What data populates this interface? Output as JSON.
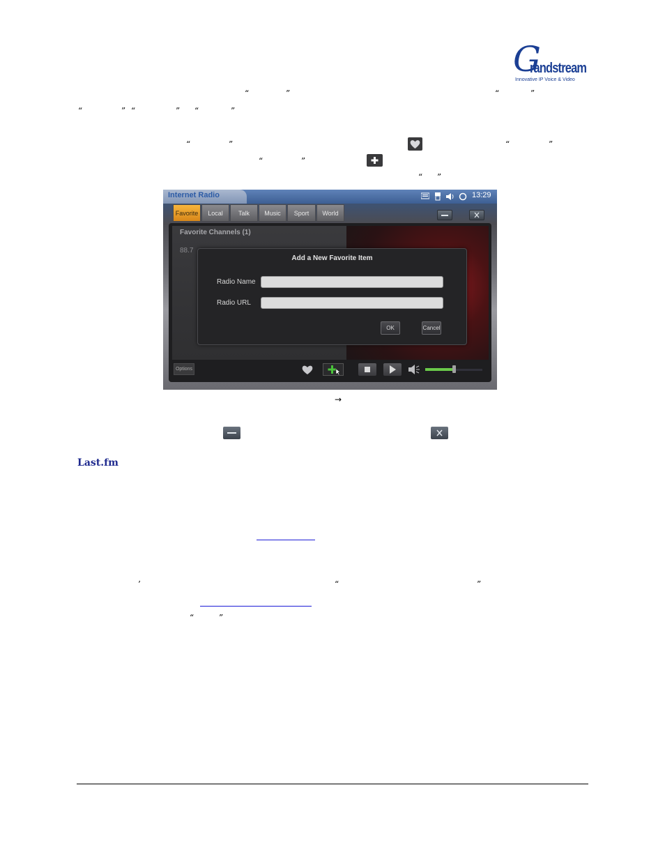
{
  "brand": {
    "logo_initial": "G",
    "logo_rest": "randstream",
    "tagline": "Innovative IP Voice & Video",
    "color": "#1b3f94"
  },
  "doc": {
    "section_heading": "Last.fm",
    "arrow_glyph": "→",
    "heading_color": "#1f2a8f",
    "link_color": "#1b1bd6"
  },
  "icons": {
    "heart": "heart-icon",
    "add": "plus-icon",
    "minimize": "minimize-icon",
    "close": "close-icon"
  },
  "screen": {
    "app_title": "Internet Radio",
    "clock": "13:29",
    "tabs": [
      {
        "label": "Favorite",
        "active": true
      },
      {
        "label": "Local",
        "active": false
      },
      {
        "label": "Talk",
        "active": false
      },
      {
        "label": "Music",
        "active": false
      },
      {
        "label": "Sport",
        "active": false
      },
      {
        "label": "World",
        "active": false
      }
    ],
    "favorites_heading": "Favorite Channels (1)",
    "favorite_item": "88.7",
    "options_label": "Options",
    "dialog": {
      "title": "Add a New Favorite Item",
      "name_label": "Radio Name",
      "name_value": "",
      "url_label": "Radio URL",
      "url_value": "",
      "ok_label": "OK",
      "cancel_label": "Cancel"
    },
    "volume_level": 0.5,
    "accent_tab_color": "#f0a030",
    "volume_color": "#6ac94a"
  }
}
